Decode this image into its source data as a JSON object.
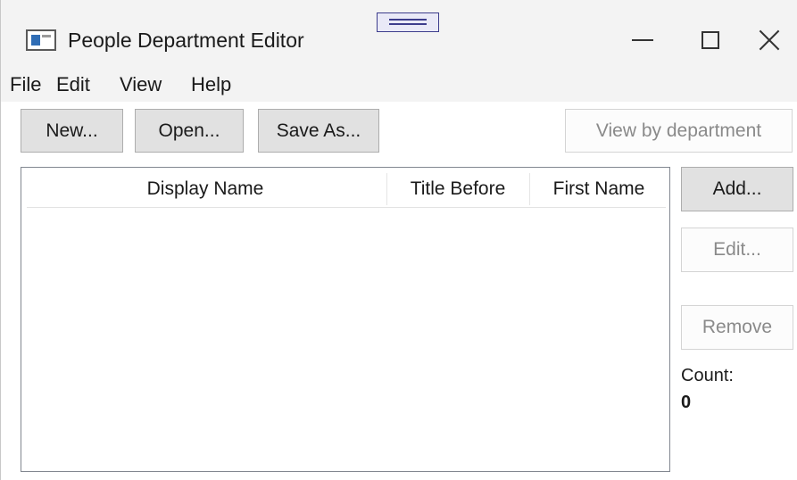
{
  "window": {
    "title": "People Department Editor"
  },
  "menu": {
    "items": [
      "File",
      "Edit",
      "View",
      "Help"
    ]
  },
  "toolbar": {
    "new_label": "New...",
    "open_label": "Open...",
    "save_as_label": "Save As...",
    "view_by_department_label": "View by department"
  },
  "list": {
    "columns": [
      "Display Name",
      "Title Before",
      "First Name"
    ],
    "rows": []
  },
  "side_buttons": {
    "add_label": "Add...",
    "edit_label": "Edit...",
    "remove_label": "Remove"
  },
  "count": {
    "label": "Count:",
    "value": "0"
  },
  "colors": {
    "accent_icon": "#2f6db5",
    "button_face": "#e1e1e1",
    "disabled_text": "#8a8a8a"
  }
}
